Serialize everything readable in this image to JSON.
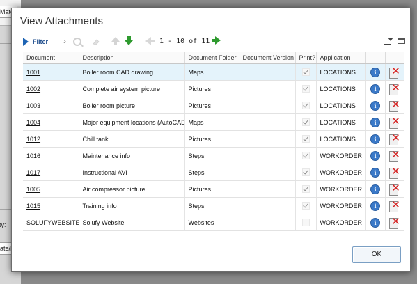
{
  "background": {
    "label_top": "Mate",
    "label_mid": "ty:",
    "label_bottom": "ate/F"
  },
  "dialog": {
    "title": "View Attachments"
  },
  "toolbar": {
    "filter_label": "Filter",
    "pager_text": "1 - 10 of 11"
  },
  "table": {
    "columns": [
      "Document",
      "Description",
      "Document Folder",
      "Document Version",
      "Print?",
      "Application"
    ],
    "rows": [
      {
        "document": "1001",
        "description": "Boiler room CAD drawing",
        "folder": "Maps",
        "version": "",
        "print": true,
        "application": "LOCATIONS"
      },
      {
        "document": "1002",
        "description": "Complete air system picture",
        "folder": "Pictures",
        "version": "",
        "print": true,
        "application": "LOCATIONS"
      },
      {
        "document": "1003",
        "description": "Boiler room picture",
        "folder": "Pictures",
        "version": "",
        "print": true,
        "application": "LOCATIONS"
      },
      {
        "document": "1004",
        "description": "Major equipment locations (AutoCAD)",
        "folder": "Maps",
        "version": "",
        "print": true,
        "application": "LOCATIONS"
      },
      {
        "document": "1012",
        "description": "Chill tank",
        "folder": "Pictures",
        "version": "",
        "print": true,
        "application": "LOCATIONS"
      },
      {
        "document": "1016",
        "description": "Maintenance info",
        "folder": "Steps",
        "version": "",
        "print": true,
        "application": "WORKORDER"
      },
      {
        "document": "1017",
        "description": "Instructional AVI",
        "folder": "Steps",
        "version": "",
        "print": true,
        "application": "WORKORDER"
      },
      {
        "document": "1005",
        "description": "Air compressor picture",
        "folder": "Pictures",
        "version": "",
        "print": true,
        "application": "WORKORDER"
      },
      {
        "document": "1015",
        "description": "Training info",
        "folder": "Steps",
        "version": "",
        "print": true,
        "application": "WORKORDER"
      },
      {
        "document": "SOLUFYWEBSITE",
        "description": "Solufy Website",
        "folder": "Websites",
        "version": "",
        "print": false,
        "application": "WORKORDER"
      }
    ],
    "selected_row": 0
  },
  "footer": {
    "ok_label": "OK"
  },
  "icons": {
    "info": "info-icon",
    "delete": "delete-icon"
  },
  "colors": {
    "selected_row": "#e4f3fb",
    "accent_blue": "#1e64b4",
    "green_arrow": "#2e9a2e",
    "delete_red": "#d62020"
  }
}
